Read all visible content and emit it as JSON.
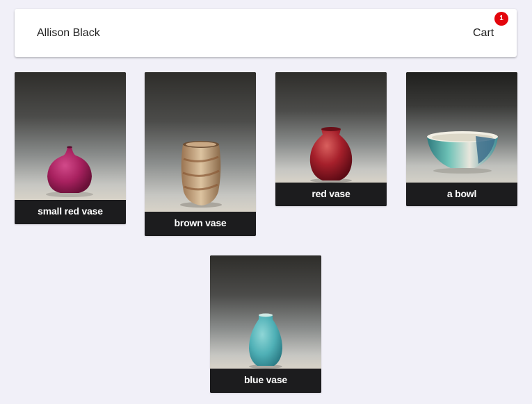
{
  "header": {
    "brand": "Allison Black",
    "cart_label": "Cart",
    "cart_count": "1"
  },
  "products": [
    {
      "name": "small red vase",
      "icon": "small-red-vase-image",
      "color": "#b02a6a"
    },
    {
      "name": "brown vase",
      "icon": "brown-vase-image",
      "color": "#c9a57a"
    },
    {
      "name": "red vase",
      "icon": "red-vase-image",
      "color": "#a8202a"
    },
    {
      "name": "a bowl",
      "icon": "bowl-image",
      "color": "#5fb3ae"
    },
    {
      "name": "blue vase",
      "icon": "blue-vase-image",
      "color": "#5ab6bb"
    }
  ]
}
